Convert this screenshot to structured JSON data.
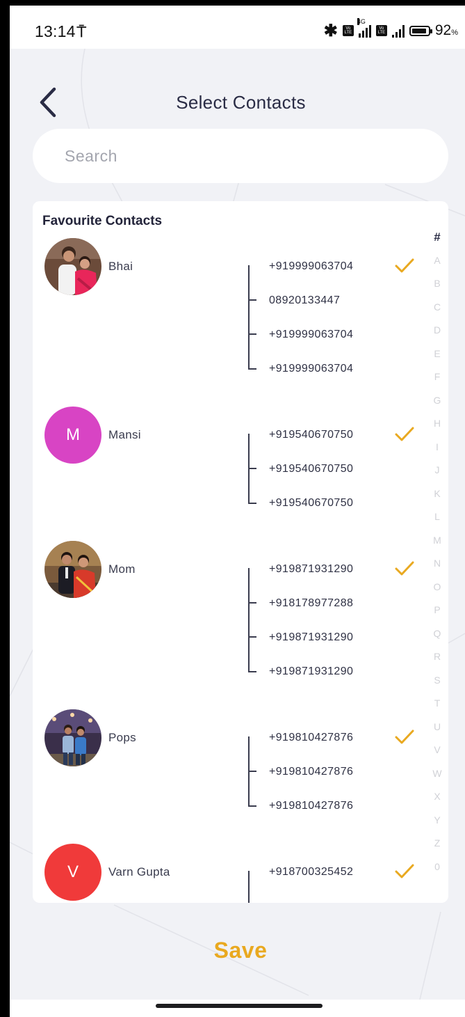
{
  "status_bar": {
    "time": "13:14",
    "carrier_icon": "jio-icon",
    "network_label": "4G",
    "volte_label": "Vo LTE",
    "battery_percent": "92",
    "battery_unit": "%",
    "battery_level": 0.92
  },
  "header": {
    "title": "Select Contacts",
    "back_icon": "chevron-left-icon"
  },
  "search": {
    "placeholder": "Search",
    "value": ""
  },
  "favourites": {
    "title": "Favourite Contacts",
    "contacts": [
      {
        "name": "Bhai",
        "avatar_type": "photo",
        "numbers": [
          "+919999063704",
          "08920133447",
          "+919999063704",
          "+919999063704"
        ],
        "selected_index": 0
      },
      {
        "name": "Mansi",
        "avatar_type": "initial",
        "initial": "M",
        "avatar_color": "#d844c4",
        "numbers": [
          "+919540670750",
          "+919540670750",
          "+919540670750"
        ],
        "selected_index": 0
      },
      {
        "name": "Mom",
        "avatar_type": "photo",
        "numbers": [
          "+919871931290",
          "+918178977288",
          "+919871931290",
          "+919871931290"
        ],
        "selected_index": 0
      },
      {
        "name": "Pops",
        "avatar_type": "photo",
        "numbers": [
          "+919810427876",
          "+919810427876",
          "+919810427876"
        ],
        "selected_index": 0
      },
      {
        "name": "Varn Gupta",
        "avatar_type": "initial",
        "initial": "V",
        "avatar_color": "#f03a3a",
        "numbers": [
          "+918700325452"
        ],
        "selected_index": 0
      }
    ]
  },
  "alpha_index": [
    "#",
    "A",
    "B",
    "C",
    "D",
    "E",
    "F",
    "G",
    "H",
    "I",
    "J",
    "K",
    "L",
    "M",
    "N",
    "O",
    "P",
    "Q",
    "R",
    "S",
    "T",
    "U",
    "V",
    "W",
    "X",
    "Y",
    "Z",
    "0"
  ],
  "alpha_active": "#",
  "save_label": "Save",
  "colors": {
    "accent": "#e9a920",
    "check": "#e9a920",
    "text_dark": "#2a2c45",
    "background": "#f1f2f6"
  }
}
